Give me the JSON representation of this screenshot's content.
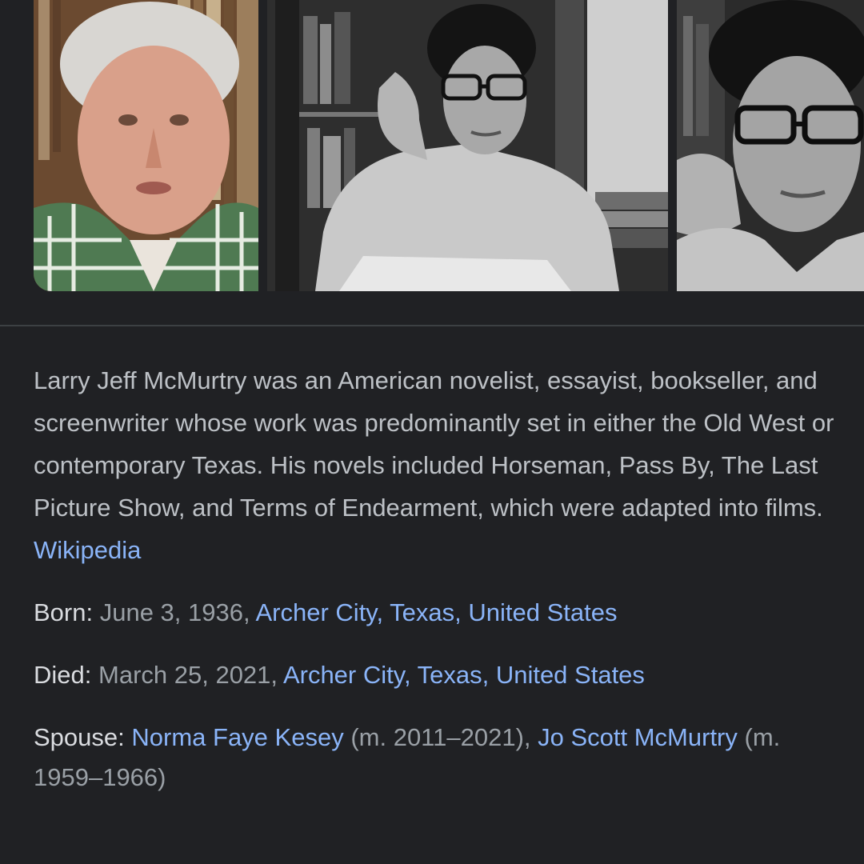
{
  "images": [
    {
      "icon": "portrait-elderly-man"
    },
    {
      "icon": "portrait-young-man-at-desk"
    },
    {
      "icon": "portrait-young-man-closeup"
    }
  ],
  "description": {
    "text": "Larry Jeff McMurtry was an American novelist, essayist, bookseller, and screenwriter whose work was predominantly set in either the Old West or contemporary Texas. His novels included Horseman, Pass By, The Last Picture Show, and Terms of Endearment, which were adapted into films.",
    "source_link": "Wikipedia"
  },
  "facts": {
    "born": {
      "label": "Born",
      "date": "June 3, 1936",
      "place_link": "Archer City, Texas, United States"
    },
    "died": {
      "label": "Died",
      "date": "March 25, 2021",
      "place_link": "Archer City, Texas, United States"
    },
    "spouse": {
      "label": "Spouse",
      "spouse1_link": "Norma Faye Kesey",
      "spouse1_years": "(m. 2011–2021)",
      "spouse2_link": "Jo Scott McMurtry",
      "spouse2_years": "(m. 1959–1966)"
    }
  },
  "colors": {
    "background": "#202124",
    "text": "#bdc1c6",
    "link": "#8ab4f8",
    "divider": "#3c4043"
  }
}
